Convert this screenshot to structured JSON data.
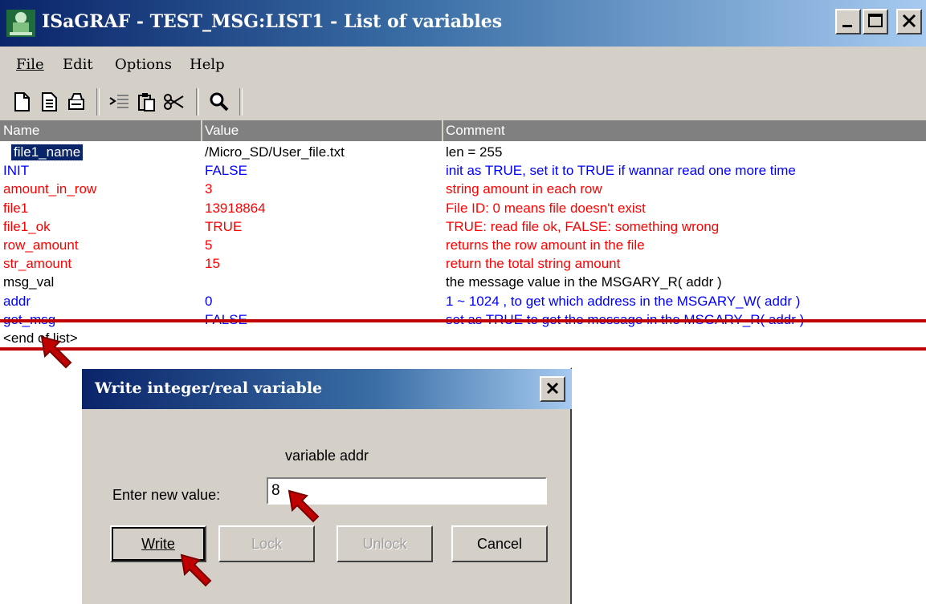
{
  "window": {
    "title": "ISaGRAF - TEST_MSG:LIST1 - List of variables",
    "minimize_icon": "minimize-icon",
    "maximize_icon": "maximize-icon",
    "close_icon": "close-icon"
  },
  "menu": {
    "items": [
      {
        "label": "File"
      },
      {
        "label": "Edit"
      },
      {
        "label": "Options"
      },
      {
        "label": "Help"
      }
    ]
  },
  "toolbar": {
    "icons": [
      "new-document-icon",
      "copy-document-icon",
      "print-icon",
      "indent-icon",
      "paste-icon",
      "cut-icon",
      "search-icon"
    ]
  },
  "list": {
    "columns": [
      "Name",
      "Value",
      "Comment"
    ],
    "rows": [
      {
        "name": "file1_name",
        "value": "/Micro_SD/User_file.txt",
        "comment": "len = 255",
        "color": "#000000"
      },
      {
        "name": "INIT",
        "value": "FALSE",
        "comment": "init as TRUE, set it to TRUE if wannar read one more time",
        "color": "#0000ff"
      },
      {
        "name": "amount_in_row",
        "value": "3",
        "comment": "string amount in each row",
        "color": "#ff0000"
      },
      {
        "name": "file1",
        "value": "13918864",
        "comment": "File ID:  0 means file doesn't exist",
        "color": "#ff0000"
      },
      {
        "name": "file1_ok",
        "value": "TRUE",
        "comment": "TRUE: read file ok, FALSE: something wrong",
        "color": "#ff0000"
      },
      {
        "name": "row_amount",
        "value": "5",
        "comment": "returns the row amount in the file",
        "color": "#ff0000"
      },
      {
        "name": "str_amount",
        "value": "15",
        "comment": "return the total string amount",
        "color": "#ff0000"
      },
      {
        "name": "msg_val",
        "value": "",
        "comment": "the message value in the MSGARY_R( addr )",
        "color": "#000000"
      },
      {
        "name": "addr",
        "value": "0",
        "comment": "1 ~ 1024 , to get which address in the MSGARY_W( addr )",
        "color": "#0000ff"
      },
      {
        "name": "get_msg",
        "value": "FALSE",
        "comment": "set as TRUE to get the message in the MSGARY_R( addr )",
        "color": "#0000ff"
      },
      {
        "name": "<end of list>",
        "value": "",
        "comment": "",
        "color": "#000000"
      }
    ]
  },
  "dialog": {
    "title": "Write integer/real variable",
    "variable_label": "variable addr",
    "prompt": "Enter new value:",
    "input_value": "8",
    "buttons": {
      "write": "Write",
      "lock": "Lock",
      "unlock": "Unlock",
      "cancel": "Cancel"
    }
  },
  "colors": {
    "title_gradient_start": "#0a246a",
    "selection": "#0a246a",
    "highlight_marker": "#c00000"
  }
}
